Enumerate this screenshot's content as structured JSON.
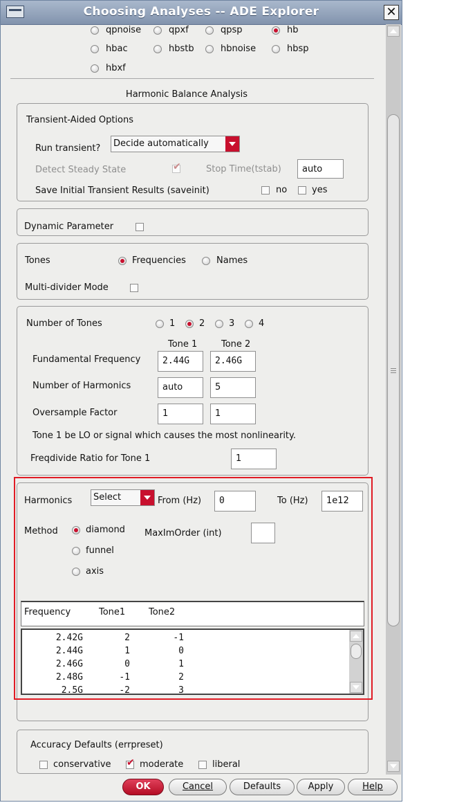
{
  "window": {
    "title": "Choosing Analyses -- ADE Explorer",
    "close_glyph": "✕"
  },
  "analyses": [
    {
      "label": "qpnoise",
      "selected": false
    },
    {
      "label": "qpxf",
      "selected": false
    },
    {
      "label": "qpsp",
      "selected": false
    },
    {
      "label": "hb",
      "selected": true
    },
    {
      "label": "hbac",
      "selected": false
    },
    {
      "label": "hbstb",
      "selected": false
    },
    {
      "label": "hbnoise",
      "selected": false
    },
    {
      "label": "hbsp",
      "selected": false
    },
    {
      "label": "hbxf",
      "selected": false
    }
  ],
  "section_title": "Harmonic Balance Analysis",
  "transient": {
    "heading": "Transient-Aided Options",
    "run_label": "Run transient?",
    "run_value": "Decide automatically",
    "detect_label": "Detect Steady State",
    "detect_checked": true,
    "stop_label": "Stop Time(tstab)",
    "stop_value": "auto",
    "saveinit_label": "Save Initial Transient Results (saveinit)",
    "no_label": "no",
    "yes_label": "yes"
  },
  "dynamic": {
    "label": "Dynamic Parameter",
    "checked": false
  },
  "tones": {
    "label": "Tones",
    "opt_frequencies": "Frequencies",
    "opt_names": "Names",
    "selected": "Frequencies",
    "multidivider_label": "Multi-divider Mode",
    "multidivider_checked": false
  },
  "tone_setup": {
    "num_label": "Number of Tones",
    "options": [
      "1",
      "2",
      "3",
      "4"
    ],
    "selected": "2",
    "col1": "Tone 1",
    "col2": "Tone 2",
    "fund_label": "Fundamental Frequency",
    "fund_values": [
      "2.44G",
      "2.46G"
    ],
    "harm_label": "Number of Harmonics",
    "harm_values": [
      "auto",
      "5"
    ],
    "over_label": "Oversample Factor",
    "over_values": [
      "1",
      "1"
    ],
    "note": "Tone 1 be LO or signal which causes the most nonlinearity.",
    "freqdiv_label": "Freqdivide Ratio for Tone 1",
    "freqdiv_value": "1"
  },
  "harmonics": {
    "label": "Harmonics",
    "select_value": "Select",
    "from_label": "From (Hz)",
    "from_value": "0",
    "to_label": "To (Hz)",
    "to_value": "1e12",
    "method_label": "Method",
    "methods": [
      "diamond",
      "funnel",
      "axis"
    ],
    "method_selected": "diamond",
    "maxim_label": "MaxImOrder (int)",
    "maxim_value": "",
    "table_headers": [
      "Frequency",
      "Tone1",
      "Tone2"
    ],
    "rows": [
      [
        "2.42G",
        "2",
        "-1"
      ],
      [
        "2.44G",
        "1",
        "0"
      ],
      [
        "2.46G",
        "0",
        "1"
      ],
      [
        "2.48G",
        "-1",
        "2"
      ],
      [
        "2.5G",
        "-2",
        "3"
      ]
    ],
    "highlight_color": "#e01b24"
  },
  "accuracy": {
    "label": "Accuracy Defaults (errpreset)",
    "options": [
      "conservative",
      "moderate",
      "liberal"
    ],
    "selected": "moderate"
  },
  "buttons": {
    "ok": "OK",
    "cancel": "Cancel",
    "defaults": "Defaults",
    "apply": "Apply",
    "help": "Help"
  }
}
